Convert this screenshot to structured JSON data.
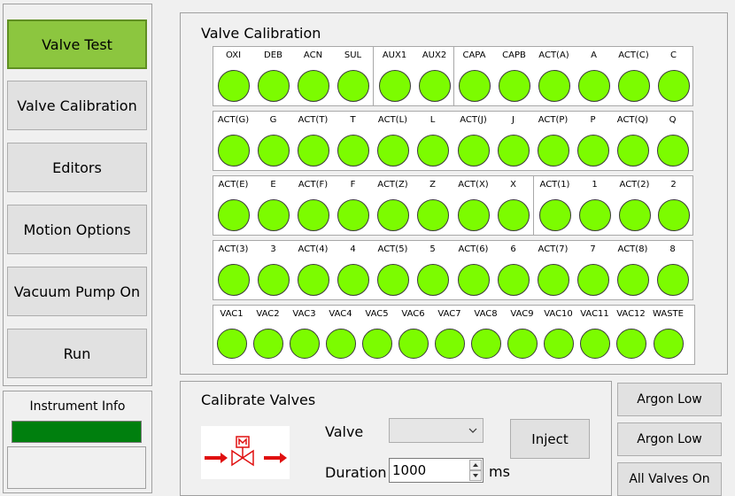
{
  "nav": {
    "buttons": [
      "Valve Test",
      "Valve Calibration",
      "Editors",
      "Motion Options",
      "Vacuum Pump On",
      "Run"
    ],
    "active_index": 0,
    "active_color": "#8cc63f"
  },
  "instrument": {
    "title": "Instrument Info",
    "status_color": "#007f0e",
    "text": ""
  },
  "valve_calibration": {
    "title": "Valve Calibration",
    "led_color": "#7cfc00",
    "rows": [
      [
        "OXI",
        "DEB",
        "ACN",
        "SUL",
        "AUX1",
        "AUX2",
        "CAPA",
        "CAPB",
        "ACT(A)",
        "A",
        "ACT(C)",
        "C"
      ],
      [
        "ACT(G)",
        "G",
        "ACT(T)",
        "T",
        "ACT(L)",
        "L",
        "ACT(J)",
        "J",
        "ACT(P)",
        "P",
        "ACT(Q)",
        "Q"
      ],
      [
        "ACT(E)",
        "E",
        "ACT(F)",
        "F",
        "ACT(Z)",
        "Z",
        "ACT(X)",
        "X",
        "ACT(1)",
        "1",
        "ACT(2)",
        "2"
      ],
      [
        "ACT(3)",
        "3",
        "ACT(4)",
        "4",
        "ACT(5)",
        "5",
        "ACT(6)",
        "6",
        "ACT(7)",
        "7",
        "ACT(8)",
        "8"
      ],
      [
        "VAC1",
        "VAC2",
        "VAC3",
        "VAC4",
        "VAC5",
        "VAC6",
        "VAC7",
        "VAC8",
        "VAC9",
        "VAC10",
        "VAC11",
        "VAC12",
        "WASTE"
      ]
    ]
  },
  "calibrate": {
    "title": "Calibrate Valves",
    "valve_label": "Valve",
    "valve_value": "",
    "duration_label": "Duration",
    "duration_value": "1000",
    "duration_unit": "ms",
    "inject_label": "Inject"
  },
  "side_buttons": [
    "Argon Low",
    "Argon Low",
    "All Valves On"
  ]
}
